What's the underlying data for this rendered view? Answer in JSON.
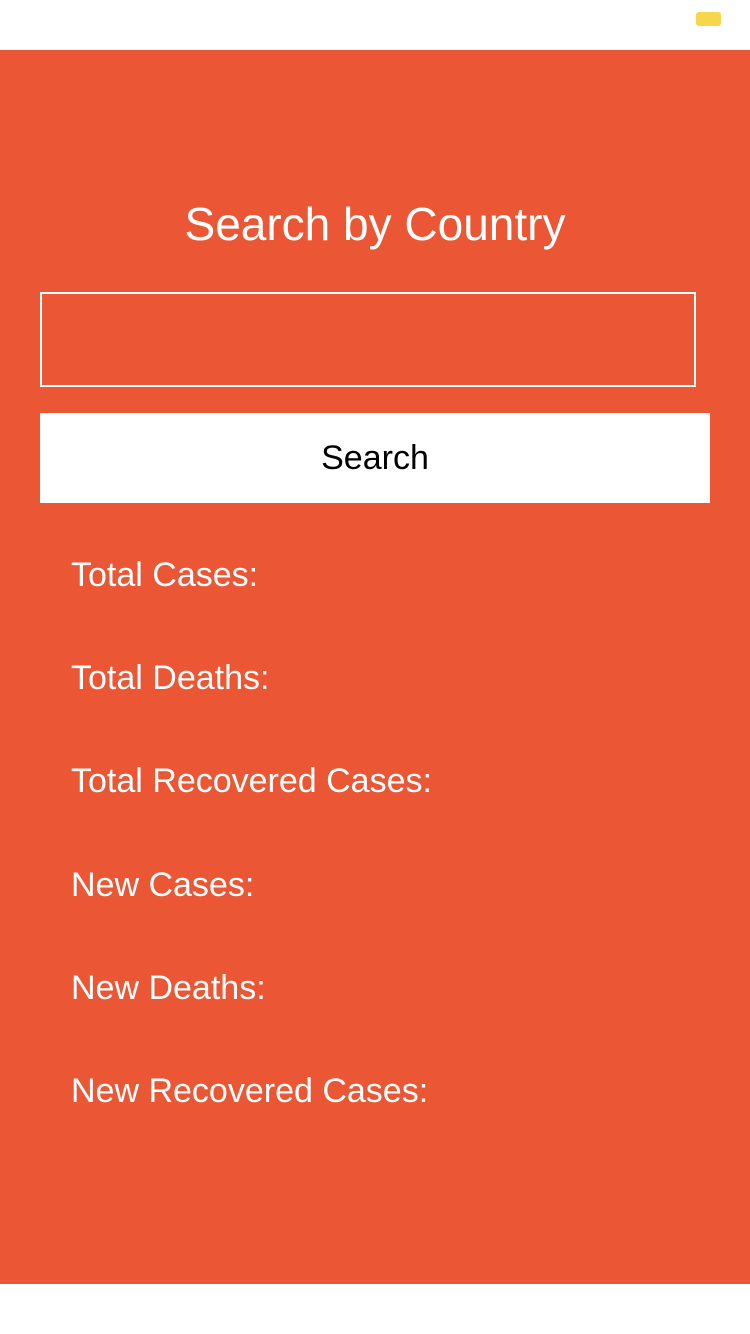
{
  "status_bar": {
    "battery_icon": "battery-icon",
    "battery_color": "#f7d64a"
  },
  "colors": {
    "background": "#eb5734",
    "accent_text": "#ffffff"
  },
  "page": {
    "title": "Search by Country"
  },
  "search": {
    "input_value": "",
    "button_label": "Search"
  },
  "stats": {
    "total_cases": "Total Cases:",
    "total_deaths": "Total Deaths:",
    "total_recovered": "Total Recovered Cases:",
    "new_cases": "New Cases:",
    "new_deaths": "New Deaths:",
    "new_recovered": "New Recovered Cases:"
  }
}
